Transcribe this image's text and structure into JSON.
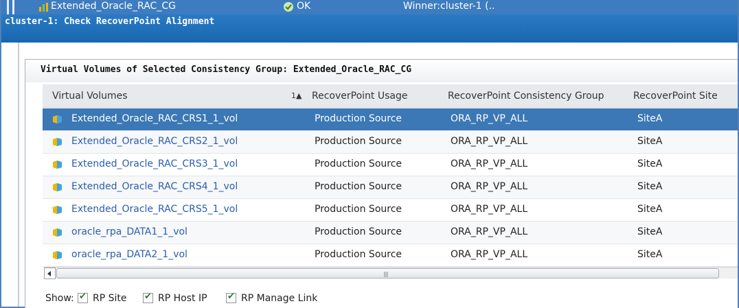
{
  "top_row": {
    "consistency_group": "Extended_Oracle_RAC_CG",
    "status": "OK",
    "winner": "Winner:cluster-1 (.."
  },
  "window": {
    "title": "cluster-1: Check RecoverPoint Alignment"
  },
  "panel": {
    "heading": "Virtual Volumes of Selected Consistency Group: Extended_Oracle_RAC_CG"
  },
  "table": {
    "columns": [
      "Virtual Volumes",
      "RecoverPoint Usage",
      "RecoverPoint Consistency Group",
      "RecoverPoint Site"
    ],
    "sort_indicator": "1▲",
    "rows": [
      {
        "volume": "Extended_Oracle_RAC_CRS1_1_vol",
        "usage": "Production Source",
        "cg": "ORA_RP_VP_ALL",
        "site": "SiteA"
      },
      {
        "volume": "Extended_Oracle_RAC_CRS2_1_vol",
        "usage": "Production Source",
        "cg": "ORA_RP_VP_ALL",
        "site": "SiteA"
      },
      {
        "volume": "Extended_Oracle_RAC_CRS3_1_vol",
        "usage": "Production Source",
        "cg": "ORA_RP_VP_ALL",
        "site": "SiteA"
      },
      {
        "volume": "Extended_Oracle_RAC_CRS4_1_vol",
        "usage": "Production Source",
        "cg": "ORA_RP_VP_ALL",
        "site": "SiteA"
      },
      {
        "volume": "Extended_Oracle_RAC_CRS5_1_vol",
        "usage": "Production Source",
        "cg": "ORA_RP_VP_ALL",
        "site": "SiteA"
      },
      {
        "volume": "oracle_rpa_DATA1_1_vol",
        "usage": "Production Source",
        "cg": "ORA_RP_VP_ALL",
        "site": "SiteA"
      },
      {
        "volume": "oracle_rpa_DATA2_1_vol",
        "usage": "Production Source",
        "cg": "ORA_RP_VP_ALL",
        "site": "SiteA"
      }
    ],
    "selected_row": 0
  },
  "footer": {
    "show_label": "Show:",
    "checkboxes": [
      {
        "label": "RP Site",
        "checked": true
      },
      {
        "label": "RP Host IP",
        "checked": true
      },
      {
        "label": "RP Manage Link",
        "checked": true
      }
    ]
  },
  "colors": {
    "title_bar": "#1766b0",
    "selected_row": "#3b78b5",
    "link_text": "#2a5db0"
  }
}
